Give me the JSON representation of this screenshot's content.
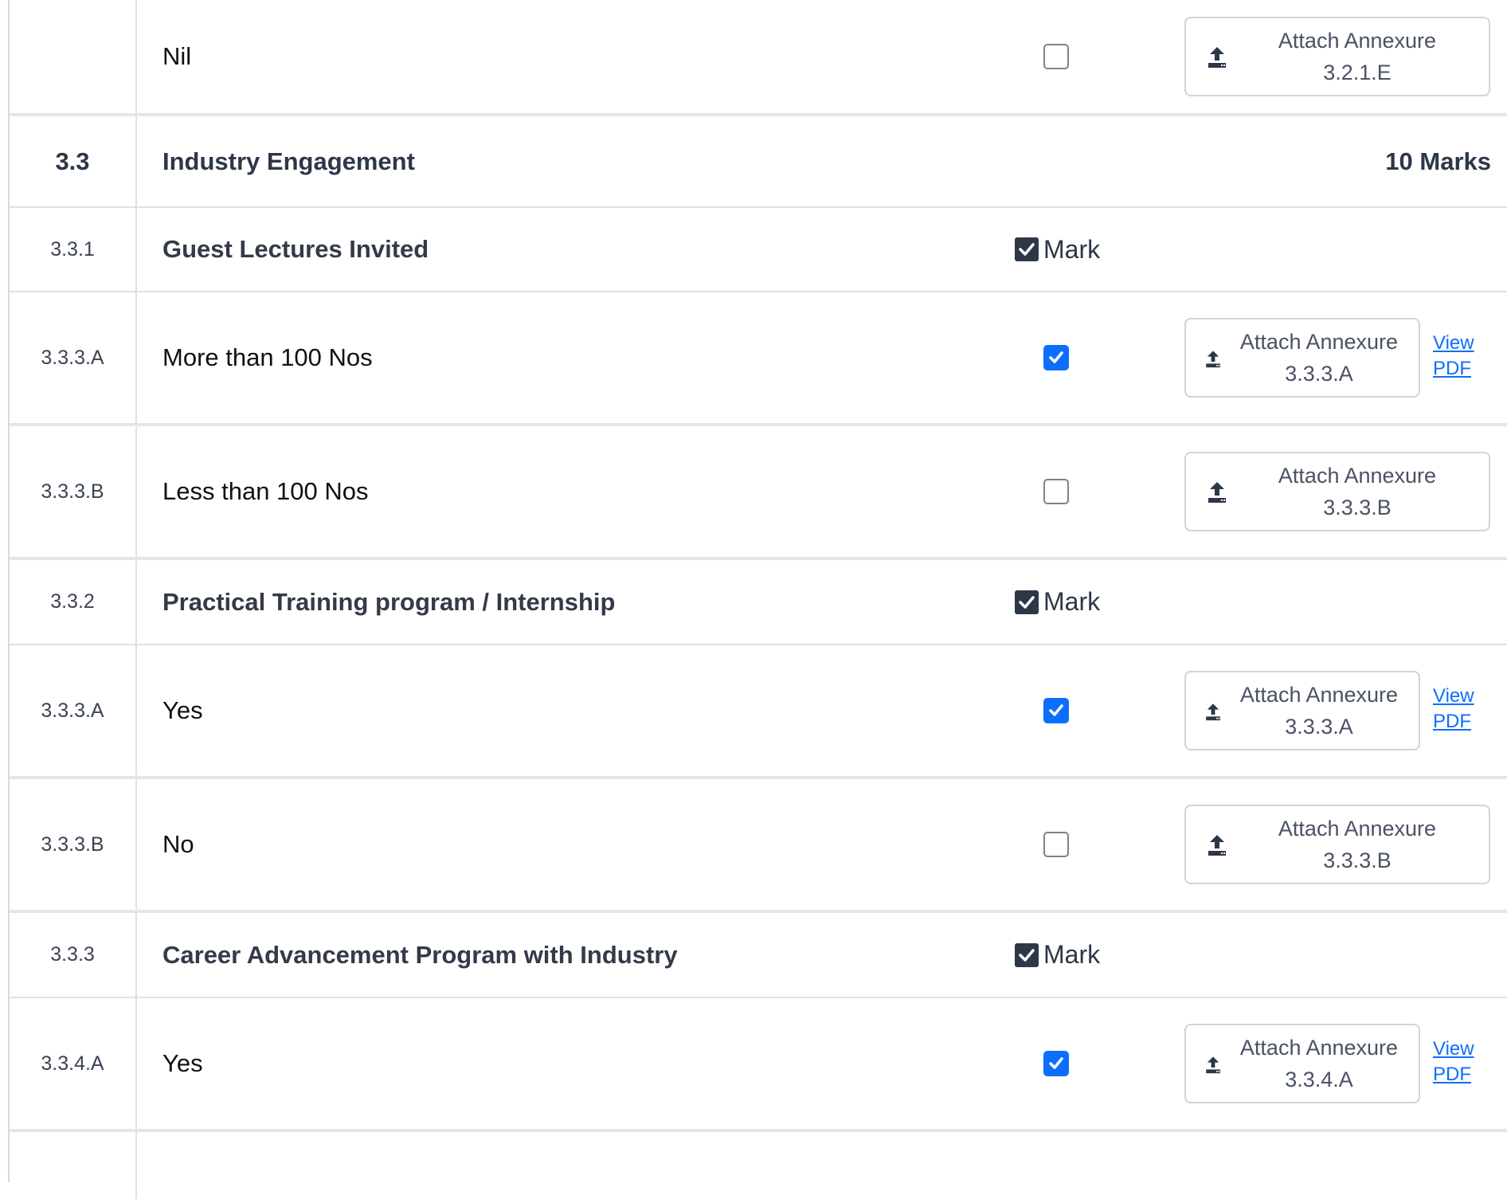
{
  "rows": [
    {
      "text": "Nil",
      "checked": false,
      "annexure_label": "Attach Annexure",
      "annexure_code": "3.2.1.E"
    },
    {
      "num": "3.3",
      "title": "Industry Engagement",
      "marks": "10 Marks"
    },
    {
      "num": "3.3.1",
      "title": "Guest Lectures Invited",
      "mark_label": "Mark"
    },
    {
      "num": "3.3.3.A",
      "text": "More than 100 Nos",
      "checked": true,
      "annexure_label": "Attach Annexure",
      "annexure_code": "3.3.3.A",
      "view_label": "View PDF"
    },
    {
      "num": "3.3.3.B",
      "text": "Less than 100 Nos",
      "checked": false,
      "annexure_label": "Attach Annexure",
      "annexure_code": "3.3.3.B"
    },
    {
      "num": "3.3.2",
      "title": "Practical Training program / Internship",
      "mark_label": "Mark"
    },
    {
      "num": "3.3.3.A",
      "text": "Yes",
      "checked": true,
      "annexure_label": "Attach Annexure",
      "annexure_code": "3.3.3.A",
      "view_label": "View PDF"
    },
    {
      "num": "3.3.3.B",
      "text": "No",
      "checked": false,
      "annexure_label": "Attach Annexure",
      "annexure_code": "3.3.3.B"
    },
    {
      "num": "3.3.3",
      "title": "Career Advancement Program with Industry",
      "mark_label": "Mark"
    },
    {
      "num": "3.3.4.A",
      "text": "Yes",
      "checked": true,
      "annexure_label": "Attach Annexure",
      "annexure_code": "3.3.4.A",
      "view_label": "View PDF"
    }
  ],
  "icons": {
    "upload": "upload-icon",
    "check": "checkmark-icon"
  },
  "colors": {
    "checked_blue": "#0d6efd",
    "mark_dark": "#2d3748",
    "link_blue": "#0d6efd"
  }
}
